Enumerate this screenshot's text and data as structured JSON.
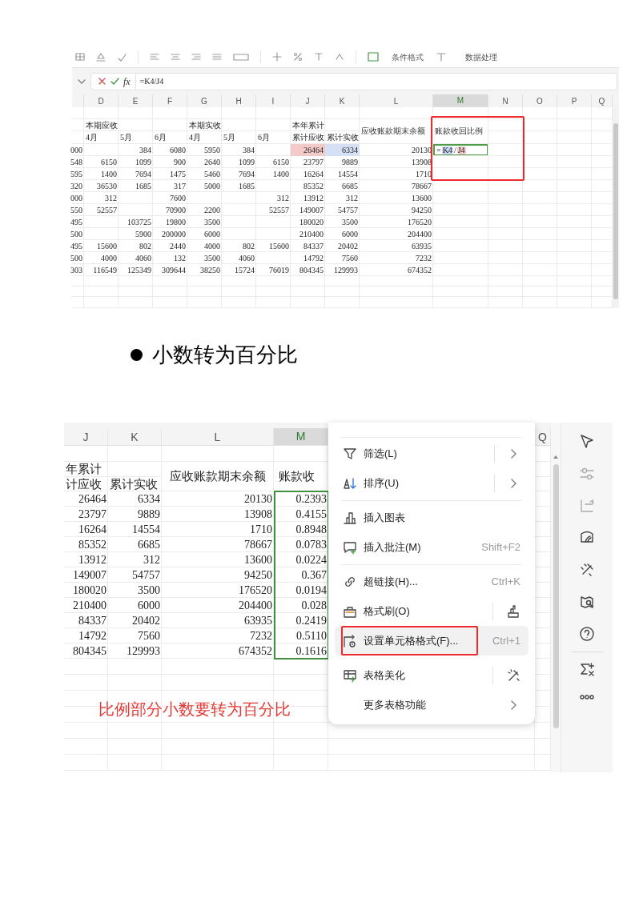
{
  "sheet_1": {
    "toolbar_labels": [
      "条件格式",
      "数据处理"
    ],
    "formula_bar": {
      "function_label": "fx",
      "formula": "=K4/J4"
    },
    "column_headers": [
      {
        "label": "D",
        "selected": false
      },
      {
        "label": "E",
        "selected": false
      },
      {
        "label": "F",
        "selected": false
      },
      {
        "label": "G",
        "selected": false
      },
      {
        "label": "H",
        "selected": false
      },
      {
        "label": "I",
        "selected": false
      },
      {
        "label": "J",
        "selected": false
      },
      {
        "label": "K",
        "selected": false
      },
      {
        "label": "L",
        "selected": false
      },
      {
        "label": "M",
        "selected": true
      },
      {
        "label": "N",
        "selected": false
      },
      {
        "label": "O",
        "selected": false
      },
      {
        "label": "P",
        "selected": false
      },
      {
        "label": "Q",
        "selected": false
      }
    ],
    "header_rows": [
      [
        null,
        "本期应收",
        null,
        null,
        "本期实收",
        null,
        null,
        "本年累计",
        null,
        null
      ],
      [
        null,
        "4月",
        "5月",
        "6月",
        "4月",
        "5月",
        "6月",
        "累计应收",
        "累计实收",
        null
      ]
    ],
    "tall_headers": [
      "应收账款期末余额",
      "账款收回比例"
    ],
    "rows": [
      [
        "000",
        null,
        "384",
        "6080",
        "5950",
        "384",
        null,
        {
          "text": "26464",
          "color": "#f3c9c9"
        },
        {
          "text": "6334",
          "color": "#d6e0f5"
        },
        "20130"
      ],
      [
        "548",
        "6150",
        "1099",
        "900",
        "2640",
        "1099",
        "6150",
        "23797",
        "9889",
        "13908"
      ],
      [
        "595",
        "1400",
        "7694",
        "1475",
        "5460",
        "7694",
        "1400",
        "16264",
        "14554",
        "1710"
      ],
      [
        "320",
        "36530",
        "1685",
        "317",
        "5000",
        "1685",
        null,
        "85352",
        "6685",
        "78667"
      ],
      [
        "000",
        "312",
        null,
        "7600",
        null,
        null,
        "312",
        "13912",
        "312",
        "13600"
      ],
      [
        "550",
        "52557",
        null,
        "70900",
        "2200",
        null,
        "52557",
        "149007",
        "54757",
        "94250"
      ],
      [
        "495",
        null,
        "103725",
        "19800",
        "3500",
        null,
        null,
        "180020",
        "3500",
        "176520"
      ],
      [
        "500",
        null,
        "5900",
        "200000",
        "6000",
        null,
        null,
        "210400",
        "6000",
        "204400"
      ],
      [
        "495",
        "15600",
        "802",
        "2440",
        "4000",
        "802",
        "15600",
        "84337",
        "20402",
        "63935"
      ],
      [
        "500",
        "4000",
        "4060",
        "132",
        "3500",
        "4060",
        null,
        "14792",
        "7560",
        "7232"
      ],
      [
        "303",
        "116549",
        "125349",
        "309644",
        "38250",
        "15724",
        "76019",
        "804345",
        "129993",
        "674352"
      ]
    ],
    "editing_cell": {
      "tokens": [
        {
          "text": "=",
          "kind": "operator"
        },
        {
          "text": "K4",
          "kind": "reference",
          "color": "#c9d6f2"
        },
        {
          "text": "/",
          "kind": "operator"
        },
        {
          "text": "J4",
          "kind": "reference",
          "color": "#f2caca"
        }
      ]
    }
  },
  "bullet": {
    "text": "小数转为百分比"
  },
  "sheet_2": {
    "column_headers": [
      {
        "label": "J",
        "selected": false
      },
      {
        "label": "K",
        "selected": false
      },
      {
        "label": "L",
        "selected": false
      },
      {
        "label": "M",
        "selected": true
      },
      {
        "label": "Q",
        "selected": false
      }
    ],
    "header_rows": [
      [
        "年累计",
        null
      ],
      [
        "计应收",
        "累计实收"
      ]
    ],
    "tall_headers": [
      "应收账款期末余额",
      "账款收"
    ],
    "rows": [
      [
        "26464",
        "6334",
        "20130",
        "0.2393"
      ],
      [
        "23797",
        "9889",
        "13908",
        "0.4155"
      ],
      [
        "16264",
        "14554",
        "1710",
        "0.8948"
      ],
      [
        "85352",
        "6685",
        "78667",
        "0.0783"
      ],
      [
        "13912",
        "312",
        "13600",
        "0.0224"
      ],
      [
        "149007",
        "54757",
        "94250",
        "0.367"
      ],
      [
        "180020",
        "3500",
        "176520",
        "0.0194"
      ],
      [
        "210400",
        "6000",
        "204400",
        "0.028"
      ],
      [
        "84337",
        "20402",
        "63935",
        "0.2419"
      ],
      [
        "14792",
        "7560",
        "7232",
        "0.5110"
      ],
      [
        "804345",
        "129993",
        "674352",
        "0.1616"
      ]
    ],
    "note": "比例部分小数要转为百分比",
    "context_menu": [
      {
        "label": "筛选(L)",
        "kind": "submenu",
        "selected": false,
        "marked": false,
        "divider_after": false
      },
      {
        "label": "排序(U)",
        "kind": "submenu",
        "selected": false,
        "marked": false,
        "divider_after": true
      },
      {
        "label": "插入图表",
        "kind": "plain",
        "selected": false,
        "marked": false,
        "divider_after": false
      },
      {
        "label": "插入批注(M)",
        "kind": "shortcut",
        "shortcut": "Shift+F2",
        "selected": false,
        "marked": false,
        "divider_after": true
      },
      {
        "label": "超链接(H)...",
        "kind": "shortcut",
        "shortcut": "Ctrl+K",
        "selected": false,
        "marked": false,
        "divider_after": false
      },
      {
        "label": "格式刷(O)",
        "kind": "tool",
        "selected": false,
        "marked": false,
        "divider_after": false
      },
      {
        "label": "设置单元格格式(F)...",
        "kind": "shortcut",
        "shortcut": "Ctrl+1",
        "selected": true,
        "marked": true,
        "divider_after": false
      },
      {
        "label": "表格美化",
        "kind": "tool",
        "selected": false,
        "marked": false,
        "divider_after": false
      },
      {
        "label": "更多表格功能",
        "kind": "submenu",
        "selected": false,
        "marked": false,
        "divider_after": false
      }
    ]
  }
}
